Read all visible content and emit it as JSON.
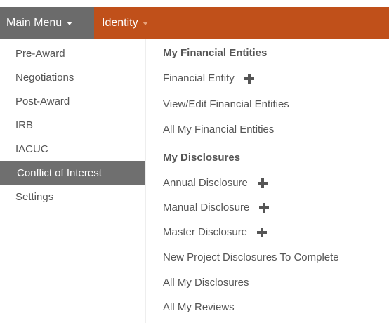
{
  "topbar": {
    "main_menu_label": "Main Menu",
    "identity_label": "Identity",
    "bar_color": "#c0501a",
    "main_menu_bg": "#6b6b6b"
  },
  "left_menu": {
    "items": [
      {
        "label": "Pre-Award"
      },
      {
        "label": "Negotiations"
      },
      {
        "label": "Post-Award"
      },
      {
        "label": "IRB"
      },
      {
        "label": "IACUC"
      },
      {
        "label": "Conflict of Interest",
        "active": true
      },
      {
        "label": "Settings"
      }
    ]
  },
  "submenu": {
    "financial_entities": {
      "heading": "My Financial Entities",
      "items": [
        {
          "label": "Financial Entity",
          "icon": "plus-icon"
        },
        {
          "label": "View/Edit Financial Entities"
        },
        {
          "label": "All My Financial Entities"
        }
      ]
    },
    "disclosures": {
      "heading": "My Disclosures",
      "items": [
        {
          "label": "Annual Disclosure",
          "icon": "plus-icon"
        },
        {
          "label": "Manual Disclosure",
          "icon": "plus-icon"
        },
        {
          "label": "Master Disclosure",
          "icon": "plus-icon"
        },
        {
          "label": "New Project Disclosures To Complete"
        },
        {
          "label": "All My Disclosures"
        },
        {
          "label": "All My Reviews"
        }
      ]
    }
  }
}
